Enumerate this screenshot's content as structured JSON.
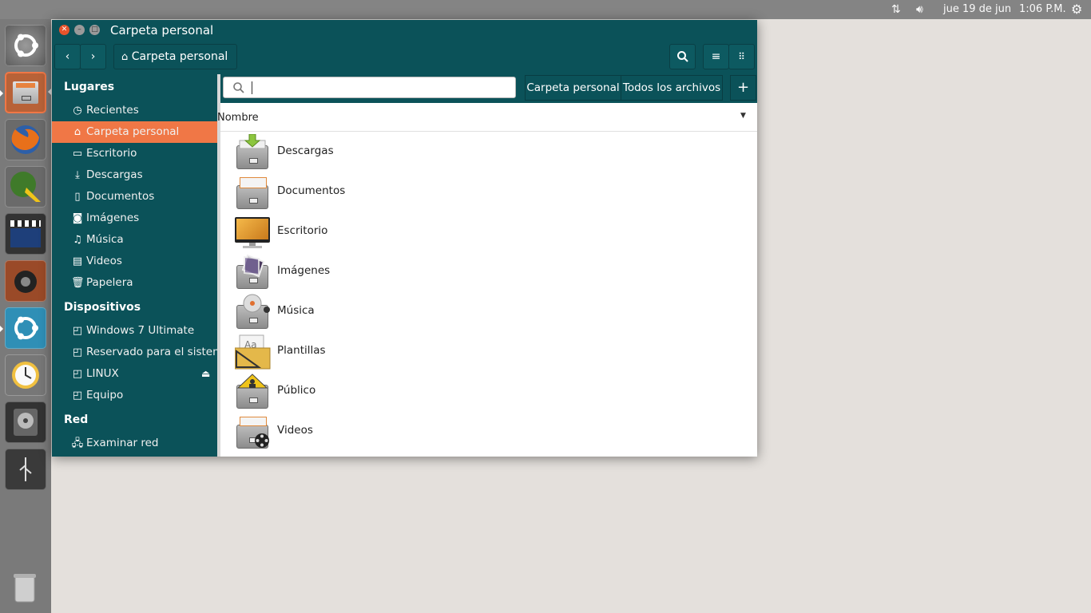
{
  "panel": {
    "network_icon": "network-arrows-icon",
    "volume_icon": "volume-icon",
    "date": "jue 19 de jun",
    "time": "1:06 P.M.",
    "session_icon": "gear-icon"
  },
  "launcher": {
    "items": [
      {
        "name": "ubuntu-dash-icon"
      },
      {
        "name": "files-icon"
      },
      {
        "name": "firefox-icon"
      },
      {
        "name": "qgis-icon"
      },
      {
        "name": "video-editor-icon"
      },
      {
        "name": "music-player-icon"
      },
      {
        "name": "software-updater-icon"
      },
      {
        "name": "backup-icon"
      },
      {
        "name": "disk-utility-icon"
      },
      {
        "name": "usb-icon"
      },
      {
        "name": "trash-icon"
      }
    ]
  },
  "window": {
    "title": "Carpeta personal",
    "path_button": "Carpeta personal",
    "accent": "#f07746",
    "bg": "#0b5259"
  },
  "sidebar": {
    "places_heading": "Lugares",
    "places": [
      {
        "label": "Recientes",
        "icon": "clock-icon"
      },
      {
        "label": "Carpeta personal",
        "icon": "home-icon",
        "active": true
      },
      {
        "label": "Escritorio",
        "icon": "folder-icon"
      },
      {
        "label": "Descargas",
        "icon": "download-icon"
      },
      {
        "label": "Documentos",
        "icon": "document-icon"
      },
      {
        "label": "Imágenes",
        "icon": "camera-icon"
      },
      {
        "label": "Música",
        "icon": "music-icon"
      },
      {
        "label": "Videos",
        "icon": "film-icon"
      },
      {
        "label": "Papelera",
        "icon": "trash-icon"
      }
    ],
    "devices_heading": "Dispositivos",
    "devices": [
      {
        "label": "Windows 7 Ultimate",
        "icon": "drive-icon"
      },
      {
        "label": "Reservado para el sistema",
        "icon": "drive-icon"
      },
      {
        "label": "LINUX",
        "icon": "drive-icon",
        "eject": true
      },
      {
        "label": "Equipo",
        "icon": "drive-icon"
      }
    ],
    "network_heading": "Red",
    "network": [
      {
        "label": "Examinar red",
        "icon": "network-icon"
      }
    ]
  },
  "locationbar": {
    "search_placeholder": "",
    "home_button": "Carpeta personal",
    "all_files_button": "Todos los archivos",
    "add_button": "+"
  },
  "list": {
    "column_name": "Nombre",
    "files": [
      {
        "name": "Descargas",
        "icon": "downloads-folder-icon"
      },
      {
        "name": "Documentos",
        "icon": "documents-folder-icon"
      },
      {
        "name": "Escritorio",
        "icon": "desktop-folder-icon"
      },
      {
        "name": "Imágenes",
        "icon": "pictures-folder-icon"
      },
      {
        "name": "Música",
        "icon": "music-folder-icon"
      },
      {
        "name": "Plantillas",
        "icon": "templates-folder-icon"
      },
      {
        "name": "Público",
        "icon": "public-folder-icon"
      },
      {
        "name": "Videos",
        "icon": "videos-folder-icon"
      }
    ]
  }
}
